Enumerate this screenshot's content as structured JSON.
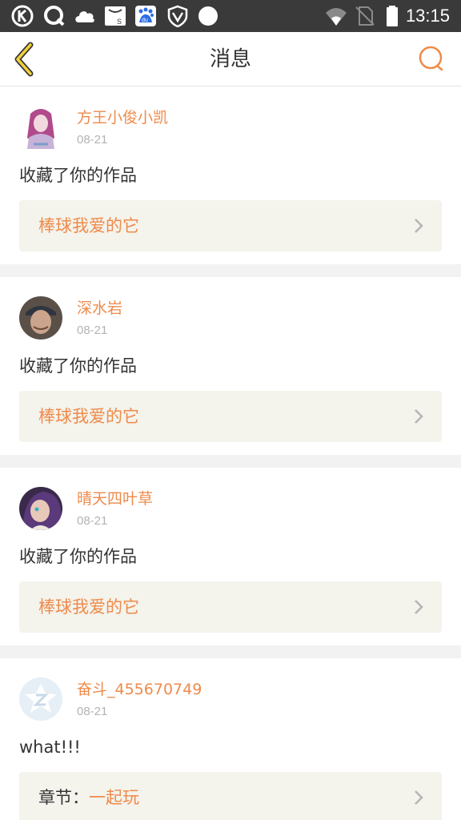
{
  "status_bar": {
    "time": "13:15",
    "left_icons": [
      "k-app-icon",
      "q-app-icon",
      "cloud-icon",
      "s-bag-icon",
      "baidu-du-icon",
      "shield-v-icon",
      "circle-icon"
    ],
    "right_icons": [
      "wifi-icon",
      "no-sim-icon",
      "battery-icon"
    ]
  },
  "header": {
    "title": "消息",
    "back_icon": "chevron-left-icon",
    "search_icon": "search-icon",
    "accent_color": "#ef8a4a"
  },
  "messages": [
    {
      "user": "方王小俊小凯",
      "date": "08-21",
      "text": "收藏了你的作品",
      "work_prefix": "",
      "work_title": "棒球我爱的它",
      "avatar": "avatar-anime-girl-pink"
    },
    {
      "user": "深水岩",
      "date": "08-21",
      "text": "收藏了你的作品",
      "work_prefix": "",
      "work_title": "棒球我爱的它",
      "avatar": "avatar-man-cap"
    },
    {
      "user": "晴天四叶草",
      "date": "08-21",
      "text": "收藏了你的作品",
      "work_prefix": "",
      "work_title": "棒球我爱的它",
      "avatar": "avatar-anime-girl-purple"
    },
    {
      "user": "奋斗_455670749",
      "date": "08-21",
      "text": "what!!!",
      "work_prefix": "章节：",
      "work_title": "一起玩",
      "avatar": "avatar-default-z"
    }
  ]
}
